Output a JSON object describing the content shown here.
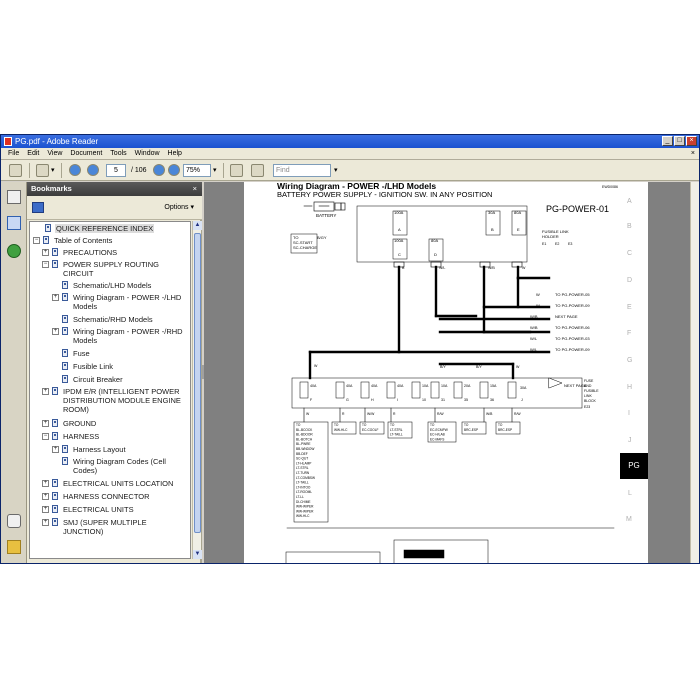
{
  "window": {
    "title": "PG.pdf - Adobe Reader"
  },
  "menu": [
    "File",
    "Edit",
    "View",
    "Document",
    "Tools",
    "Window",
    "Help"
  ],
  "toolbar": {
    "page_current": "5",
    "page_total": "/ 106",
    "zoom": "75%",
    "find_placeholder": "Find"
  },
  "bookmarks": {
    "title": "Bookmarks",
    "options_label": "Options ▾",
    "items": [
      {
        "label": "QUICK REFERENCE INDEX",
        "selected": true
      },
      {
        "label": "Table of Contents"
      },
      {
        "label": "PRECAUTIONS"
      },
      {
        "label": "POWER SUPPLY ROUTING",
        "label2": "CIRCUIT"
      },
      {
        "label": "Schematic/LHD Models"
      },
      {
        "label": "Wiring Diagram - POWER -/LHD",
        "label2": "Models"
      },
      {
        "label": "Schematic/RHD Models"
      },
      {
        "label": "Wiring Diagram - POWER -/RHD",
        "label2": "Models"
      },
      {
        "label": "Fuse"
      },
      {
        "label": "Fusible Link"
      },
      {
        "label": "Circuit Breaker"
      },
      {
        "label": "IPDM E/R (INTELLIGENT POWER",
        "label2": "DISTRIBUTION MODULE ENGINE",
        "label3": "ROOM)"
      },
      {
        "label": "GROUND"
      },
      {
        "label": "HARNESS"
      },
      {
        "label": "Harness Layout"
      },
      {
        "label": "Wiring Diagram Codes (Cell",
        "label2": "Codes)"
      },
      {
        "label": "ELECTRICAL UNITS LOCATION"
      },
      {
        "label": "HARNESS CONNECTOR"
      },
      {
        "label": "ELECTRICAL UNITS"
      },
      {
        "label": "SMJ (SUPER MULTIPLE",
        "label2": "JUNCTION)"
      }
    ]
  },
  "document": {
    "heading": "Wiring Diagram - POWER -/LHD Models",
    "subheading": "BATTERY POWER SUPPLY - IGNITION SW. IN ANY POSITION",
    "page_code": "EWD0086",
    "diagram_id": "PG-POWER-01",
    "battery_label": "BATTERY",
    "side_letters": [
      "A",
      "B",
      "C",
      "D",
      "E",
      "F",
      "G",
      "H",
      "I",
      "J",
      "PG",
      "L",
      "M"
    ],
    "active_tab": "PG",
    "top_fuses": [
      "100A",
      "100A",
      "80A",
      "30A",
      "80A"
    ],
    "top_fuse_letters": [
      "A",
      "C",
      "D",
      "B",
      "E"
    ],
    "fusible_label_1": "FUSIBLE LINK",
    "fusible_label_2": "HOLDER",
    "holder_codes": [
      "E1",
      "E2",
      "E3"
    ],
    "left_block_1": "TO",
    "left_block_2": "SC-START",
    "left_block_3": "SC-CHARGE",
    "wire_byw": "B/GY",
    "top_wires": [
      "B",
      "W/L",
      "W/B",
      "W"
    ],
    "outputs": [
      {
        "wire": "W",
        "to": "TO PG-POWER-05"
      },
      {
        "wire": "W",
        "to": "TO PG-POWER-09"
      },
      {
        "wire": "W/B",
        "to": "NEXT PAGE"
      },
      {
        "wire": "W/B",
        "to": "TO PG-POWER-06"
      },
      {
        "wire": "W/L",
        "to": "TO PG-POWER-03"
      },
      {
        "wire": "W/L",
        "to": "TO PG-POWER-09"
      }
    ],
    "mid_wires": [
      "W",
      "B/Y",
      "B/Y",
      "W"
    ],
    "bottom_fuses": [
      "40A",
      "40A",
      "40A",
      "40A",
      "10A",
      "10A",
      "20A",
      "15A",
      "30A"
    ],
    "bottom_fuse_letters": [
      "F",
      "G",
      "H",
      "I",
      "10",
      "31",
      "35",
      "36",
      "J"
    ],
    "bottom_wires": [
      "W",
      "R",
      "W/W",
      "R",
      "R/W",
      "W/B",
      "R/W"
    ],
    "next_page": "NEXT PAGE",
    "fuse_block_1": "FUSE",
    "fuse_block_2": "AND",
    "fuse_block_3": "FUSIBLE",
    "fuse_block_4": "LINK",
    "fuse_block_5": "BLOCK",
    "fuse_block_code": "E23",
    "dest_blocks": [
      [
        "TO",
        "BL-BCOCK",
        "BL-BDOOR",
        "BL-BOTCH",
        "BL-PWRE",
        "BB-WNDOW",
        "BB-DEF",
        "SC-QUT",
        "LT-HLAMP",
        "LT-STRL",
        "LT-TURN",
        "LT-COMBSW",
        "LT-TAILL",
        "LT-INTOO",
        "LT-ROOML",
        "LT-LL",
        "DI-CHIME",
        "WW-WIPER",
        "WW-WIPER",
        "WW-HLC"
      ],
      [
        "TO",
        "WW-HLC"
      ],
      [
        "TO",
        "EC-COOLF"
      ],
      [
        "TO",
        "LT-STRL",
        "LT-TAILL"
      ],
      [
        "TO",
        "EC-ECMPW",
        "EC-H/LAB",
        "EC-MAFS"
      ],
      [
        "TO",
        "BRC-ESP"
      ],
      [
        "TO",
        "BRC-ESP"
      ]
    ]
  }
}
